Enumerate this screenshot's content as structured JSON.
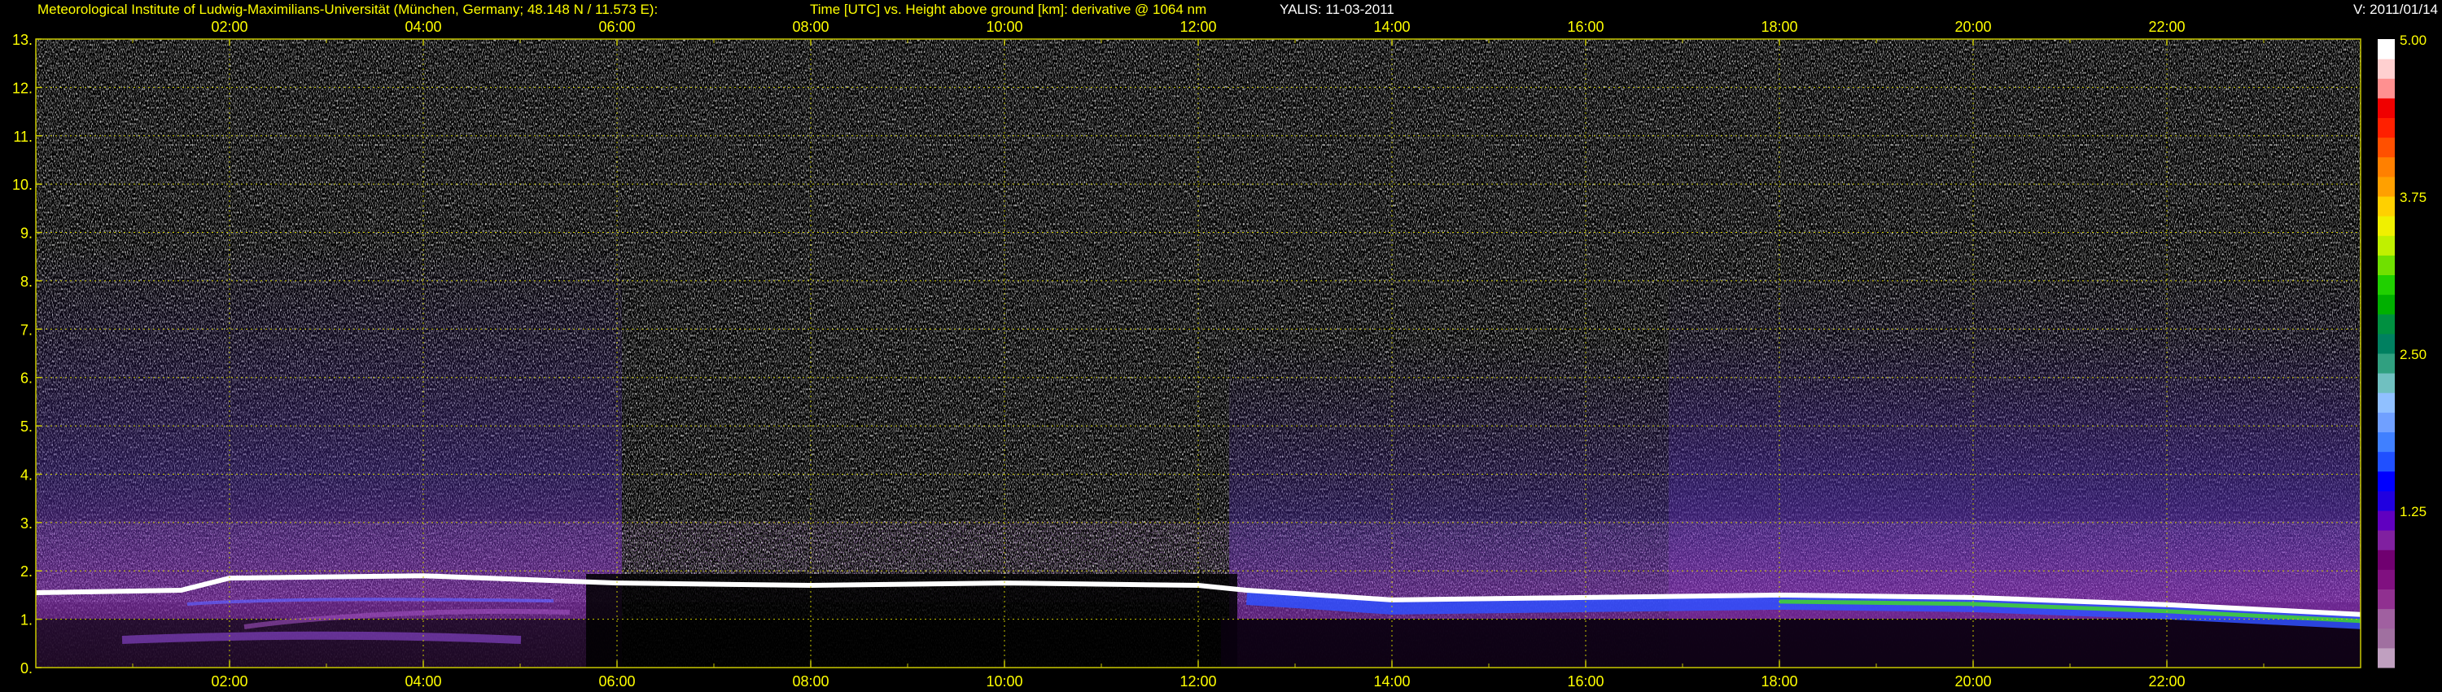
{
  "header": {
    "institute": "Meteorological Institute of Ludwig-Maximilians-Universität (München, Germany; 48.148 N / 11.573 E):",
    "description": "Time [UTC] vs. Height above ground [km]: derivative @ 1064 nm",
    "instrument_date": "YALIS: 11-03-2011",
    "version": "V: 2011/01/14"
  },
  "colors": {
    "text": "#ffff00",
    "grid": "#c8c800",
    "background": "#000000"
  },
  "chart_data": {
    "type": "heatmap",
    "x_unit": "UTC",
    "xlim": [
      "00:00",
      "24:00"
    ],
    "x_ticks": [
      "02:00",
      "04:00",
      "06:00",
      "08:00",
      "10:00",
      "12:00",
      "14:00",
      "16:00",
      "18:00",
      "20:00",
      "22:00"
    ],
    "y_ticks": [
      "0.",
      "1.",
      "2.",
      "3.",
      "4.",
      "5.",
      "6.",
      "7.",
      "8.",
      "9.",
      "10.",
      "11.",
      "12.",
      "13."
    ],
    "ylim": [
      0,
      13
    ],
    "grid": true,
    "colorbar": {
      "min": 0,
      "max": 5.0,
      "labels": [
        "5.00",
        "3.75",
        "2.50",
        "1.25"
      ],
      "colors": [
        "#c0a0c0",
        "#a070a0",
        "#a060a0",
        "#903090",
        "#801080",
        "#700070",
        "#8020a0",
        "#6000c0",
        "#2000e0",
        "#0000ff",
        "#2050ff",
        "#4080ff",
        "#70a0ff",
        "#90c0ff",
        "#70c0c0",
        "#30a080",
        "#008060",
        "#009040",
        "#00b000",
        "#20d000",
        "#70e000",
        "#c0f000",
        "#f0f000",
        "#ffd000",
        "#ffa000",
        "#ff8000",
        "#ff5000",
        "#ff2000",
        "#f00000",
        "#ff9090",
        "#ffd0d0",
        "#ffffff"
      ]
    },
    "layer_top_km": [
      {
        "time": "00:00",
        "height": 1.55
      },
      {
        "time": "01:30",
        "height": 1.6
      },
      {
        "time": "02:00",
        "height": 1.85
      },
      {
        "time": "04:00",
        "height": 1.9
      },
      {
        "time": "06:00",
        "height": 1.75
      },
      {
        "time": "08:00",
        "height": 1.7
      },
      {
        "time": "10:00",
        "height": 1.75
      },
      {
        "time": "12:00",
        "height": 1.7
      },
      {
        "time": "12:30",
        "height": 1.6
      },
      {
        "time": "14:00",
        "height": 1.4
      },
      {
        "time": "16:00",
        "height": 1.45
      },
      {
        "time": "18:00",
        "height": 1.5
      },
      {
        "time": "20:00",
        "height": 1.45
      },
      {
        "time": "22:00",
        "height": 1.3
      },
      {
        "time": "24:00",
        "height": 1.1
      }
    ]
  }
}
